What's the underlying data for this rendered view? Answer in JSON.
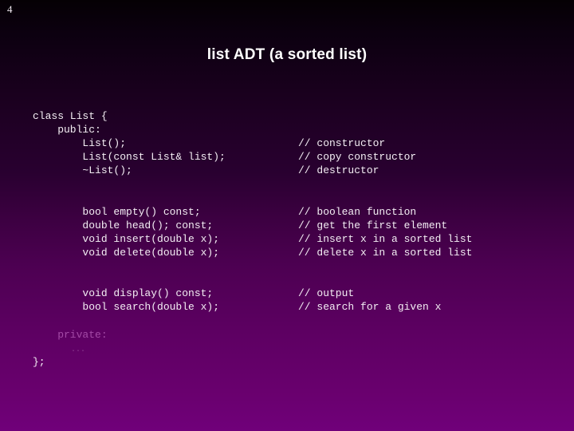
{
  "slide": {
    "page_number": "4",
    "title": "list ADT (a sorted list)",
    "colors": {
      "background_top": "#050004",
      "background_mid": "#3b0040",
      "background_bottom": "#70007a",
      "code_text": "#f4eef4",
      "title_text": "#ffffff",
      "dim_text": "#a34aa6"
    }
  },
  "code": {
    "lines": [
      {
        "code": "class List {",
        "comment": ""
      },
      {
        "code": "    public:",
        "comment": ""
      },
      {
        "code": "        List();",
        "comment": "// constructor"
      },
      {
        "code": "        List(const List& list);",
        "comment": "// copy constructor"
      },
      {
        "code": "        ~List();",
        "comment": "// destructor"
      },
      {
        "code": "",
        "comment": ""
      },
      {
        "code": "",
        "comment": ""
      },
      {
        "code": "        bool empty() const;",
        "comment": "// boolean function"
      },
      {
        "code": "        double head(); const;",
        "comment": "// get the first element"
      },
      {
        "code": "        void insert(double x);",
        "comment": "// insert x in a sorted list"
      },
      {
        "code": "        void delete(double x);",
        "comment": "// delete x in a sorted list"
      },
      {
        "code": "",
        "comment": ""
      },
      {
        "code": "",
        "comment": ""
      },
      {
        "code": "        void display() const;",
        "comment": "// output"
      },
      {
        "code": "        bool search(double x);",
        "comment": "// search for a given x"
      },
      {
        "code": "",
        "comment": ""
      },
      {
        "code": "    private:",
        "comment": "",
        "style": "dim"
      },
      {
        "code": "        ...",
        "comment": "",
        "style": "ellipsis"
      },
      {
        "code": "};",
        "comment": ""
      }
    ]
  }
}
